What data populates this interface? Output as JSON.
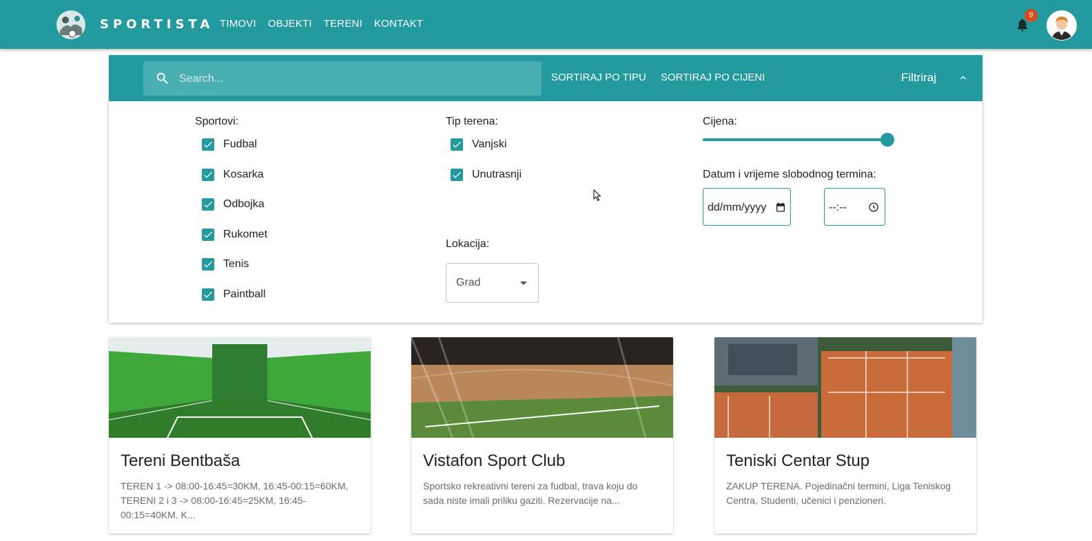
{
  "header": {
    "brand": "SPORTISTA",
    "nav": [
      "TIMOVI",
      "OBJEKTI",
      "TERENI",
      "KONTAKT"
    ],
    "notification_count": "9"
  },
  "filter_bar": {
    "search_placeholder": "Search...",
    "sort_type_label": "SORTIRAJ PO TIPU",
    "sort_price_label": "SORTIRAJ PO CIJENI",
    "filter_label": "Filtriraj"
  },
  "filters": {
    "sports_label": "Sportovi:",
    "sports": [
      {
        "label": "Fudbal",
        "checked": true
      },
      {
        "label": "Kosarka",
        "checked": true
      },
      {
        "label": "Odbojka",
        "checked": true
      },
      {
        "label": "Rukomet",
        "checked": true
      },
      {
        "label": "Tenis",
        "checked": true
      },
      {
        "label": "Paintball",
        "checked": true
      }
    ],
    "terrain_label": "Tip terena:",
    "terrain_types": [
      {
        "label": "Vanjski",
        "checked": true
      },
      {
        "label": "Unutrasnji",
        "checked": true
      }
    ],
    "price_label": "Cijena:",
    "price_slider_fraction": 1.0,
    "datetime_label": "Datum i vrijeme slobodnog termina:",
    "date_placeholder": "dd/mm/yyyy",
    "time_placeholder": "--:--",
    "location_label": "Lokacija:",
    "location_select": "Grad"
  },
  "venues": [
    {
      "title": "Tereni Bentbaša",
      "description": "TEREN 1 -> 08:00-16:45=30KM, 16:45-00:15=60KM, TERENI 2 i 3 -> 08:00-16:45=25KM, 16:45-00:15=40KM. K..."
    },
    {
      "title": "Vistafon Sport Club",
      "description": "Sportsko rekreativni tereni za fudbal, trava koju do sada niste imali priliku gaziti. Rezervacije na..."
    },
    {
      "title": "Teniski Centar Stup",
      "description": "ZAKUP TERENA. Pojedinačni termini, Liga Teniskog Centra, Studenti, učenici i penzioneri."
    }
  ],
  "colors": {
    "primary": "#229a9e",
    "badge": "#d84a1b"
  }
}
